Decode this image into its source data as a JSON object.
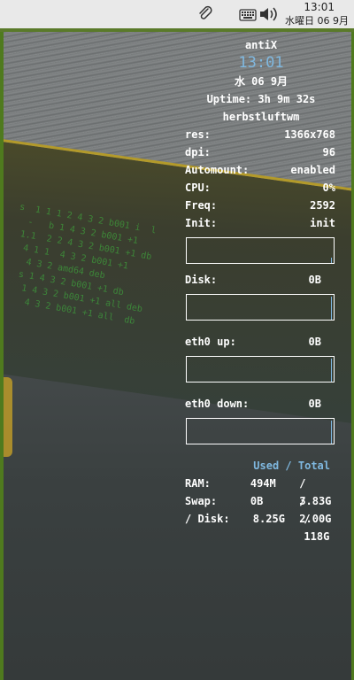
{
  "panel": {
    "time": "13:01",
    "date": "水曜日 06 9月"
  },
  "conky": {
    "hostname": "antiX",
    "clock": "13:01",
    "date": "水 06  9月",
    "uptime": "Uptime: 3h 9m 32s",
    "wm": "herbstluftwm",
    "info": [
      {
        "label": "res:",
        "value": "1366x768"
      },
      {
        "label": "dpi:",
        "value": "96"
      },
      {
        "label": "Automount:",
        "value": "enabled"
      },
      {
        "label": "CPU:",
        "value": "0%"
      },
      {
        "label": "Freq:",
        "value": "2592"
      },
      {
        "label": "Init:",
        "value": "init"
      }
    ],
    "disk": {
      "label": "Disk:",
      "value": "0B"
    },
    "eth_up": {
      "label": "eth0 up:",
      "value": "0B"
    },
    "eth_down": {
      "label": "eth0 down:",
      "value": "0B"
    },
    "mem_header": "Used / Total",
    "memory": [
      {
        "label": "RAM:",
        "used": "494M",
        "total": "/ 3.83G"
      },
      {
        "label": "Swap:",
        "used": "0B",
        "total": "/ 2.00G"
      },
      {
        "label": "/ Disk:",
        "used": "8.25G",
        "total": "/ 118G"
      }
    ]
  },
  "colors": {
    "accent": "#7fb8e0",
    "panel_border": "#5a7a2a"
  }
}
